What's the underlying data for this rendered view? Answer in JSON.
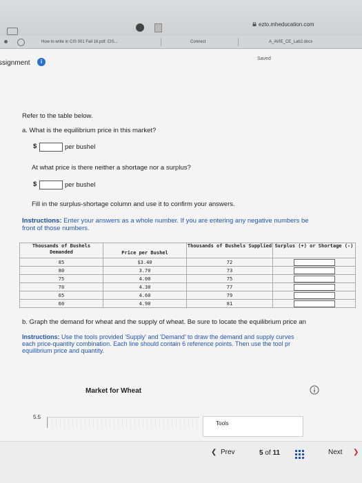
{
  "browser": {
    "url": "ezto.mheducation.com",
    "tabs": [
      {
        "label": "How to write in CIS 001 Fall 16.pdf: CIS..."
      },
      {
        "label": "Connect"
      },
      {
        "label": "A_AVIE_CE_Lab2.docx"
      }
    ]
  },
  "header": {
    "title": "ssignment",
    "info_icon_glyph": "i",
    "status": "Saved"
  },
  "question": {
    "intro": "Refer to the table below.",
    "part_a": "a. What is the equilibrium price in this market?",
    "currency": "$",
    "unit": "per bushel",
    "equilibrium_price_value": "",
    "sub_question": "At what price is there neither a shortage nor a surplus?",
    "neither_price_value": "",
    "fill_in": "Fill in the surplus-shortage column and use it to confirm your answers.",
    "instructions_label": "Instructions:",
    "instructions_text_1": " Enter your answers as a whole number. If you are entering any negative numbers be",
    "instructions_text_2": "front of those numbers."
  },
  "table": {
    "headers": {
      "demanded": "Thousands of Bushels Demanded",
      "price": "Price per Bushel",
      "supplied": "Thousands of Bushels Supplied",
      "surplus": "Surplus (+) or Shortage (-)"
    },
    "rows": [
      {
        "demanded": "85",
        "price": "$3.40",
        "supplied": "72"
      },
      {
        "demanded": "80",
        "price": "3.70",
        "supplied": "73"
      },
      {
        "demanded": "75",
        "price": "4.00",
        "supplied": "75"
      },
      {
        "demanded": "70",
        "price": "4.30",
        "supplied": "77"
      },
      {
        "demanded": "65",
        "price": "4.60",
        "supplied": "79"
      },
      {
        "demanded": "60",
        "price": "4.90",
        "supplied": "81"
      }
    ]
  },
  "part_b": {
    "text": "b. Graph the demand for wheat and the supply of wheat. Be sure to locate the equilibrium price an",
    "instructions_label": "Instructions:",
    "instructions_line_1": " Use the tools provided 'Supply' and 'Demand' to draw the demand and supply curves",
    "instructions_line_2": "each price-quantity combination. Each line should contain 6 reference points. Then use the tool pr",
    "instructions_line_3": "equilibrium price and quantity."
  },
  "graph": {
    "title": "Market for Wheat",
    "y_tick_top": "5.5",
    "tools_label": "Tools"
  },
  "nav": {
    "prev_label": "Prev",
    "page_current": "5",
    "page_of": "of",
    "page_total": "11",
    "next_label": "Next"
  },
  "colors": {
    "accent": "#2a6fd0",
    "instruction_text": "#1f55b5"
  }
}
